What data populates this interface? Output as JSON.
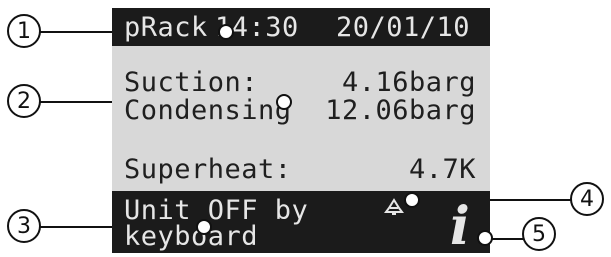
{
  "header": {
    "app_name": "pRack",
    "time": "14:30",
    "date": "20/01/10"
  },
  "readings": [
    {
      "label": "Suction:",
      "value": "4.16barg"
    },
    {
      "label": "Condensing",
      "value": "12.06barg"
    },
    {
      "label": "Superheat:",
      "value": "4.7K"
    }
  ],
  "status": {
    "line1": "Unit OFF by",
    "line2": "keyboard"
  },
  "icons": {
    "alarm": "alarm-bell-icon",
    "info": "info-icon",
    "info_glyph": "i"
  },
  "callouts": [
    "1",
    "2",
    "3",
    "4",
    "5"
  ],
  "colors": {
    "lcd_background": "#d8d8d8",
    "lcd_bar": "#1b1b1b",
    "lcd_text_light": "#e6e6e6"
  }
}
